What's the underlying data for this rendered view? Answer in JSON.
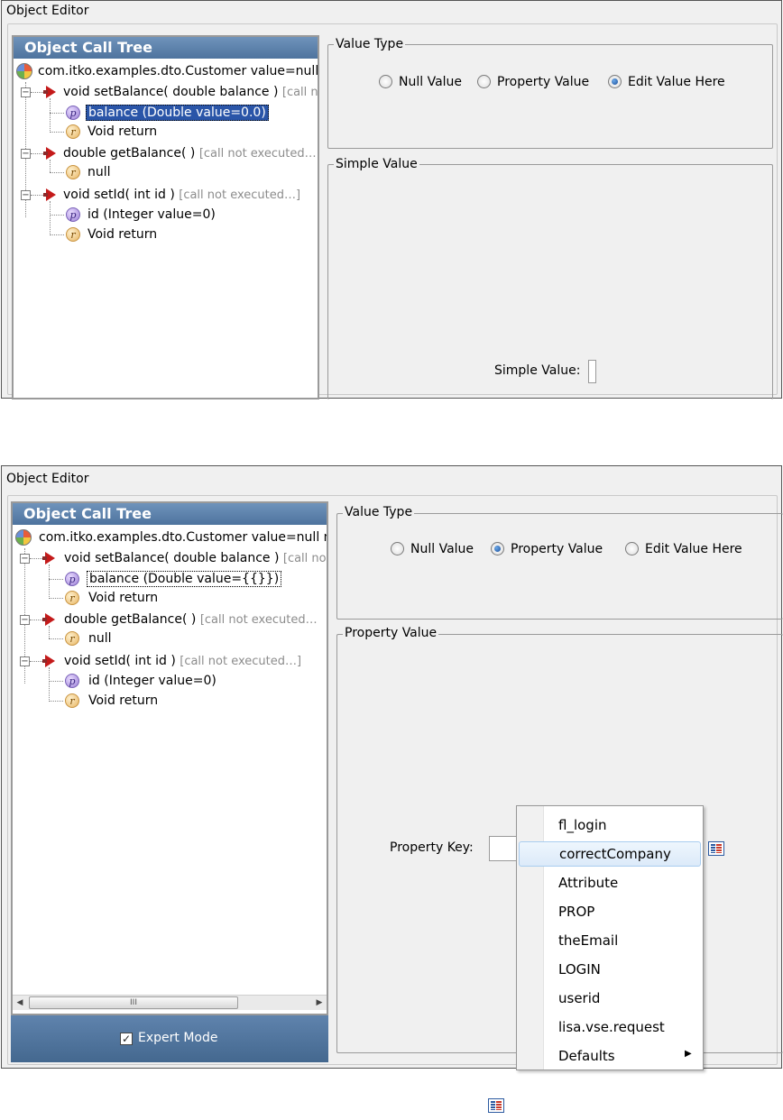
{
  "panel_top": {
    "title": "Object Editor",
    "tree": {
      "header": "Object Call Tree",
      "root": "com.itko.examples.dto.Customer value=null n",
      "set_balance": {
        "label": "void setBalance( double balance )",
        "note": "[call not"
      },
      "balance_param": "balance (Double value=0.0)",
      "void_return_1": "Void return",
      "get_balance": {
        "label": "double getBalance( )",
        "note": "[call not executed…"
      },
      "null_return": "null",
      "set_id": {
        "label": "void setId( int id )",
        "note": "[call not executed…]"
      },
      "id_param": "id (Integer value=0)",
      "void_return_2": "Void return"
    },
    "value_type": {
      "label": "Value Type",
      "options": [
        "Null Value",
        "Property Value",
        "Edit Value Here"
      ],
      "selected": "Edit Value Here"
    },
    "simple_value": {
      "group_label": "Simple Value",
      "field_label": "Simple Value:",
      "value": ""
    }
  },
  "panel_bottom": {
    "title": "Object Editor",
    "tree": {
      "header": "Object Call Tree",
      "root": "com.itko.examples.dto.Customer value=null n",
      "set_balance": {
        "label": "void setBalance( double balance )",
        "note": "[call not"
      },
      "balance_param": "balance (Double value={{}})",
      "void_return_1": "Void return",
      "get_balance": {
        "label": "double getBalance( )",
        "note": "[call not executed…"
      },
      "null_return": "null",
      "set_id": {
        "label": "void setId( int id )",
        "note": "[call not executed…]"
      },
      "id_param": "id (Integer value=0)",
      "void_return_2": "Void return",
      "scroll_thumb": "III"
    },
    "expert_mode": {
      "label": "Expert Mode",
      "checked": true
    },
    "value_type": {
      "label": "Value Type",
      "options": [
        "Null Value",
        "Property Value",
        "Edit Value Here"
      ],
      "selected": "Property Value"
    },
    "property_value": {
      "group_label": "Property Value",
      "field_label": "Property Key:",
      "value": ""
    },
    "dropdown": {
      "items": [
        "fl_login",
        "correctCompany",
        "Attribute",
        "PROP",
        "theEmail",
        "LOGIN",
        "userid",
        "lisa.vse.request",
        "Defaults"
      ],
      "highlighted": "correctCompany",
      "submenu_item": "Defaults"
    }
  },
  "icons": {
    "property_picker": "property-picker-icon"
  },
  "colors": {
    "tree_header": "#5a7fa9",
    "selection": "#2a55a8",
    "menu_hover": "#dceaf9"
  }
}
